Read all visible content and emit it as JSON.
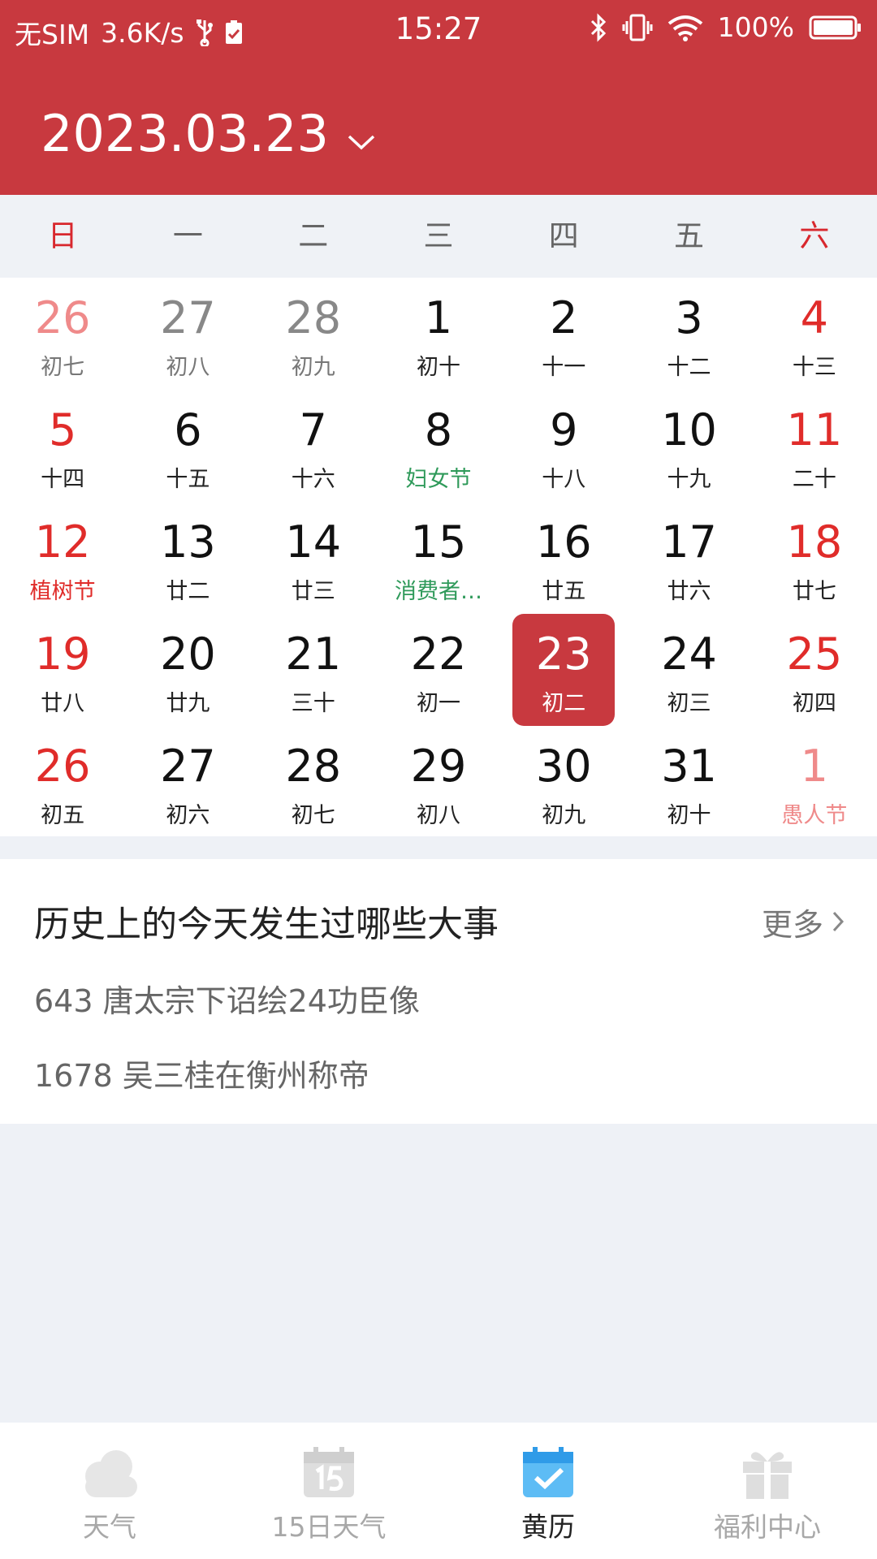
{
  "status_bar": {
    "carrier": "无SIM",
    "speed": "3.6K/s",
    "time": "15:27",
    "battery": "100%",
    "icons": [
      "usb-icon",
      "sim-check-icon",
      "bluetooth-icon",
      "vibrate-icon",
      "wifi-icon",
      "battery-icon"
    ]
  },
  "header": {
    "date": "2023.03.23"
  },
  "weekdays": [
    "日",
    "一",
    "二",
    "三",
    "四",
    "五",
    "六"
  ],
  "calendar": {
    "weeks": [
      [
        {
          "d": "26",
          "l": "初七",
          "other": true,
          "weekend": true
        },
        {
          "d": "27",
          "l": "初八",
          "other": true
        },
        {
          "d": "28",
          "l": "初九",
          "other": true
        },
        {
          "d": "1",
          "l": "初十"
        },
        {
          "d": "2",
          "l": "十一"
        },
        {
          "d": "3",
          "l": "十二"
        },
        {
          "d": "4",
          "l": "十三",
          "weekend": true
        }
      ],
      [
        {
          "d": "5",
          "l": "十四",
          "weekend": true
        },
        {
          "d": "6",
          "l": "十五"
        },
        {
          "d": "7",
          "l": "十六"
        },
        {
          "d": "8",
          "l": "妇女节",
          "festival": "green"
        },
        {
          "d": "9",
          "l": "十八"
        },
        {
          "d": "10",
          "l": "十九"
        },
        {
          "d": "11",
          "l": "二十",
          "weekend": true
        }
      ],
      [
        {
          "d": "12",
          "l": "植树节",
          "weekend": true,
          "festival": "red"
        },
        {
          "d": "13",
          "l": "廿二"
        },
        {
          "d": "14",
          "l": "廿三"
        },
        {
          "d": "15",
          "l": "消费者…",
          "festival": "green"
        },
        {
          "d": "16",
          "l": "廿五"
        },
        {
          "d": "17",
          "l": "廿六"
        },
        {
          "d": "18",
          "l": "廿七",
          "weekend": true
        }
      ],
      [
        {
          "d": "19",
          "l": "廿八",
          "weekend": true
        },
        {
          "d": "20",
          "l": "廿九"
        },
        {
          "d": "21",
          "l": "三十"
        },
        {
          "d": "22",
          "l": "初一"
        },
        {
          "d": "23",
          "l": "初二",
          "selected": true
        },
        {
          "d": "24",
          "l": "初三"
        },
        {
          "d": "25",
          "l": "初四",
          "weekend": true
        }
      ],
      [
        {
          "d": "26",
          "l": "初五",
          "weekend": true
        },
        {
          "d": "27",
          "l": "初六"
        },
        {
          "d": "28",
          "l": "初七"
        },
        {
          "d": "29",
          "l": "初八"
        },
        {
          "d": "30",
          "l": "初九"
        },
        {
          "d": "31",
          "l": "初十"
        },
        {
          "d": "1",
          "l": "愚人节",
          "other": true,
          "weekend": true,
          "festival": "red"
        }
      ]
    ]
  },
  "history": {
    "title": "历史上的今天发生过哪些大事",
    "more": "更多",
    "items": [
      "643 唐太宗下诏绘24功臣像",
      "1678 吴三桂在衡州称帝"
    ]
  },
  "tabs": [
    {
      "label": "天气",
      "icon": "cloud-icon",
      "active": false
    },
    {
      "label": "15日天气",
      "icon": "calendar-15-icon",
      "active": false
    },
    {
      "label": "黄历",
      "icon": "calendar-check-icon",
      "active": true
    },
    {
      "label": "福利中心",
      "icon": "gift-icon",
      "active": false
    }
  ],
  "colors": {
    "brand": "#c8393f",
    "weekend": "#e02c2a",
    "festival_green": "#2f9a5a",
    "active_tab": "#3aaaf0"
  }
}
